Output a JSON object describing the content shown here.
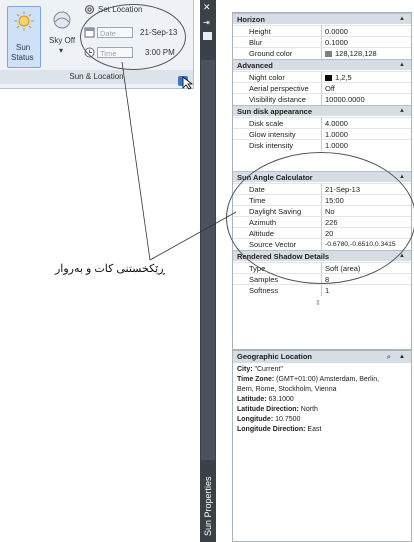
{
  "ribbon": {
    "sun_status_label_1": "Sun",
    "sun_status_label_2": "Status",
    "sky_off_label": "Sky Off",
    "set_location_label": "Set Location",
    "date_field_label": "Date",
    "date_value": "21-Sep-13",
    "time_field_label": "Time",
    "time_value": "3:00 PM",
    "panel_title": "Sun & Location"
  },
  "palette_title": "Sun Properties",
  "properties": {
    "horizon": {
      "title": "Horizon",
      "rows": [
        {
          "k": "Height",
          "v": "0.0000"
        },
        {
          "k": "Blur",
          "v": "0.1000"
        },
        {
          "k": "Ground color",
          "v": "128,128,128"
        }
      ]
    },
    "advanced": {
      "title": "Advanced",
      "rows": [
        {
          "k": "Night color",
          "v": "1,2,5"
        },
        {
          "k": "Aerial perspective",
          "v": "Off"
        },
        {
          "k": "Visibility distance",
          "v": "10000.0000"
        }
      ]
    },
    "sun_disk": {
      "title": "Sun disk appearance",
      "rows": [
        {
          "k": "Disk scale",
          "v": "4.0000"
        },
        {
          "k": "Glow intensity",
          "v": "1.0000"
        },
        {
          "k": "Disk intensity",
          "v": "1.0000"
        }
      ]
    },
    "sun_angle": {
      "title": "Sun Angle Calculator",
      "rows": [
        {
          "k": "Date",
          "v": "21-Sep-13"
        },
        {
          "k": "Time",
          "v": "15:00"
        },
        {
          "k": "Daylight Saving",
          "v": "No"
        },
        {
          "k": "Azimuth",
          "v": "226"
        },
        {
          "k": "Altitude",
          "v": "20"
        },
        {
          "k": "Source Vector",
          "v": "-0.6780,-0.6510,0.3415"
        }
      ]
    },
    "shadow": {
      "title": "Rendered Shadow Details",
      "rows": [
        {
          "k": "Type",
          "v": "Soft (area)"
        },
        {
          "k": "Samples",
          "v": "8"
        },
        {
          "k": "Softness",
          "v": "1"
        }
      ]
    }
  },
  "geo": {
    "title": "Geographic Location",
    "city_label": "City:",
    "city": "\"Current\"",
    "tz_label": "Time Zone:",
    "tz_1": "(GMT+01:00) Amsterdam, Berlin,",
    "tz_2": "Bern, Rome, Stockholm, Vienna",
    "lat_label": "Latitude:",
    "lat": "63.1000",
    "latdir_label": "Latitude Direction:",
    "latdir": "North",
    "lon_label": "Longitude:",
    "lon": "10.7500",
    "londir_label": "Longitude Direction:",
    "londir": "East"
  },
  "caption": "ڕێکخستنی کات و بەروار",
  "colors": {
    "ground_swatch": "#808080",
    "night_swatch": "#0a0a0a",
    "accent": "#3e78c4"
  }
}
